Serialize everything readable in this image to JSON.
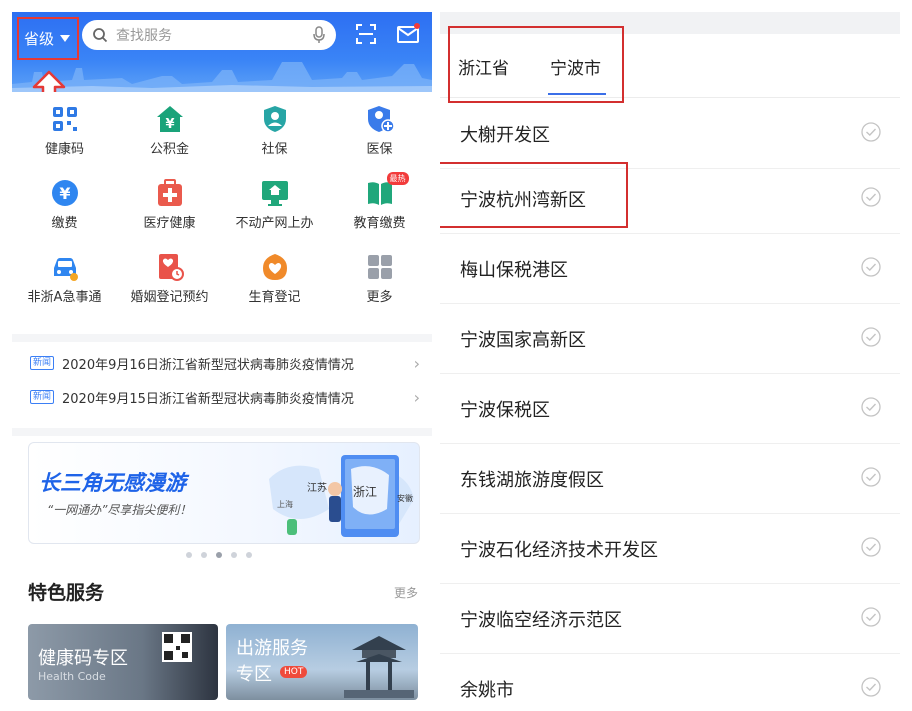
{
  "left": {
    "province_button": "省级",
    "search_placeholder": "查找服务",
    "services": [
      {
        "label": "健康码",
        "icon": "qr-code-icon",
        "color": "#2f7ae5"
      },
      {
        "label": "公积金",
        "icon": "yuan-house-icon",
        "color": "#1aa37a"
      },
      {
        "label": "社保",
        "icon": "shield-person-icon",
        "color": "#27a5a5"
      },
      {
        "label": "医保",
        "icon": "medical-shield-icon",
        "color": "#3a7bea"
      },
      {
        "label": "缴费",
        "icon": "yuan-coin-icon",
        "color": "#2f86f0"
      },
      {
        "label": "医疗健康",
        "icon": "medical-kit-icon",
        "color": "#ea5a4d"
      },
      {
        "label": "不动产网上办",
        "icon": "monitor-house-icon",
        "color": "#20a77b"
      },
      {
        "label": "教育缴费",
        "icon": "book-icon",
        "color": "#20a77b",
        "badge": "最热"
      },
      {
        "label": "非浙A急事通",
        "icon": "car-icon",
        "color": "#2f86f0"
      },
      {
        "label": "婚姻登记预约",
        "icon": "marriage-doc-icon",
        "color": "#e9534a"
      },
      {
        "label": "生育登记",
        "icon": "heart-icon",
        "color": "#f08a2a"
      },
      {
        "label": "更多",
        "icon": "more-grid-icon",
        "color": "#9aa0aa"
      }
    ],
    "news": [
      {
        "tag": "新闻",
        "text": "2020年9月16日浙江省新型冠状病毒肺炎疫情情况"
      },
      {
        "tag": "新闻",
        "text": "2020年9月15日浙江省新型冠状病毒肺炎疫情情况"
      }
    ],
    "banner": {
      "title": "长三角无感漫游",
      "subtitle": "“一网通办”尽享指尖便利！",
      "map_labels": [
        "江苏",
        "浙江",
        "安徽",
        "上海"
      ]
    },
    "featured": {
      "title": "特色服务",
      "more": "更多",
      "cards": [
        {
          "title": "健康码专区",
          "subtitle": "Health Code"
        },
        {
          "title1": "出游服务",
          "title2": "专区",
          "hot": "HOT"
        }
      ]
    }
  },
  "right": {
    "tabs": [
      "浙江省",
      "宁波市"
    ],
    "active_tab": 1,
    "districts": [
      "大榭开发区",
      "宁波杭州湾新区",
      "梅山保税港区",
      "宁波国家高新区",
      "宁波保税区",
      "东钱湖旅游度假区",
      "宁波石化经济技术开发区",
      "宁波临空经济示范区",
      "余姚市"
    ]
  },
  "colors": {
    "primary": "#2d6ff2",
    "highlight_box": "#d32f2f",
    "tab_underline": "#3b6fe8"
  }
}
